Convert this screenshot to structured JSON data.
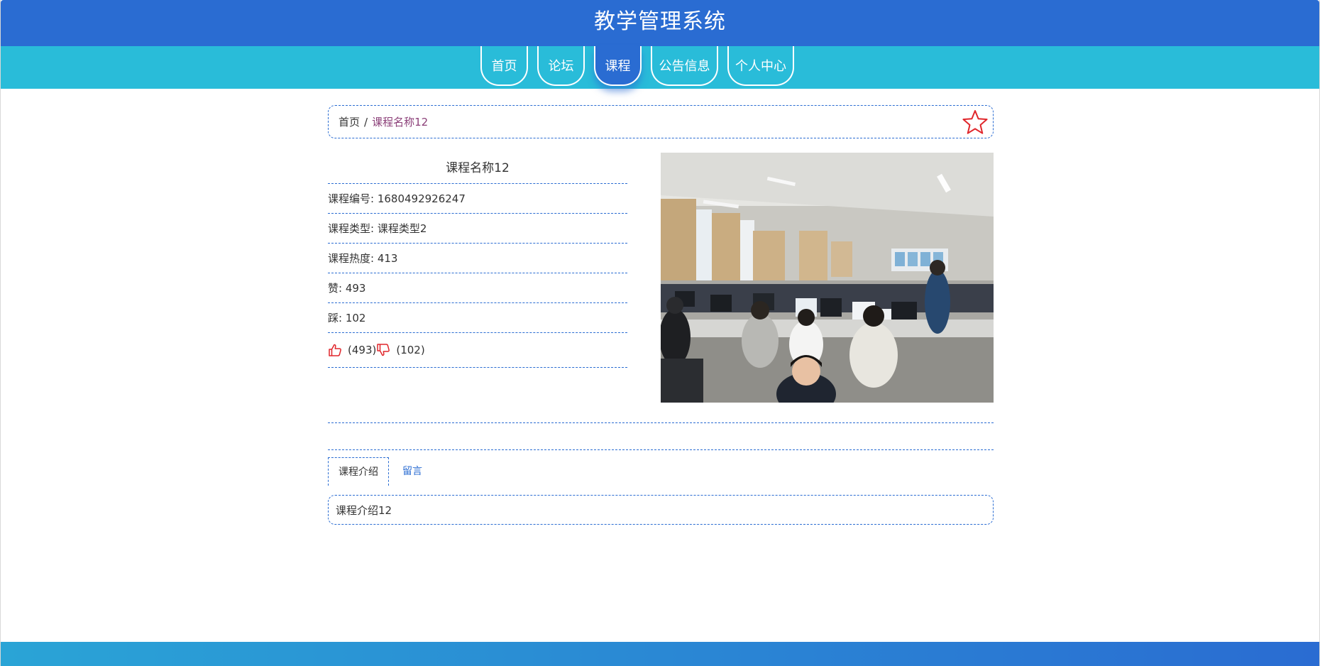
{
  "header": {
    "title": "教学管理系统"
  },
  "nav": {
    "items": [
      {
        "label": "首页"
      },
      {
        "label": "论坛"
      },
      {
        "label": "课程"
      },
      {
        "label": "公告信息"
      },
      {
        "label": "个人中心"
      }
    ],
    "active": "课程"
  },
  "breadcrumb": {
    "home": "首页",
    "separator": "/",
    "current": "课程名称12"
  },
  "course": {
    "name": "课程名称12",
    "number_label": "课程编号: 1680492926247",
    "type_label": "课程类型: 课程类型2",
    "heat_label": "课程热度: 413",
    "likes_label": "赞: 493",
    "dislikes_label": "踩: 102",
    "like_count": "(493)",
    "dislike_count": "(102)"
  },
  "tabs": {
    "intro": "课程介绍",
    "comments": "留言"
  },
  "intro_text": "课程介绍12",
  "icons": {
    "favorite": "star-outline-icon",
    "like": "thumbs-up-icon",
    "dislike": "thumbs-down-icon"
  },
  "colors": {
    "primary": "#2a6cd2",
    "nav": "#29bcd9",
    "accent_red": "#e0262b",
    "crumb_current": "#8b3f78"
  }
}
